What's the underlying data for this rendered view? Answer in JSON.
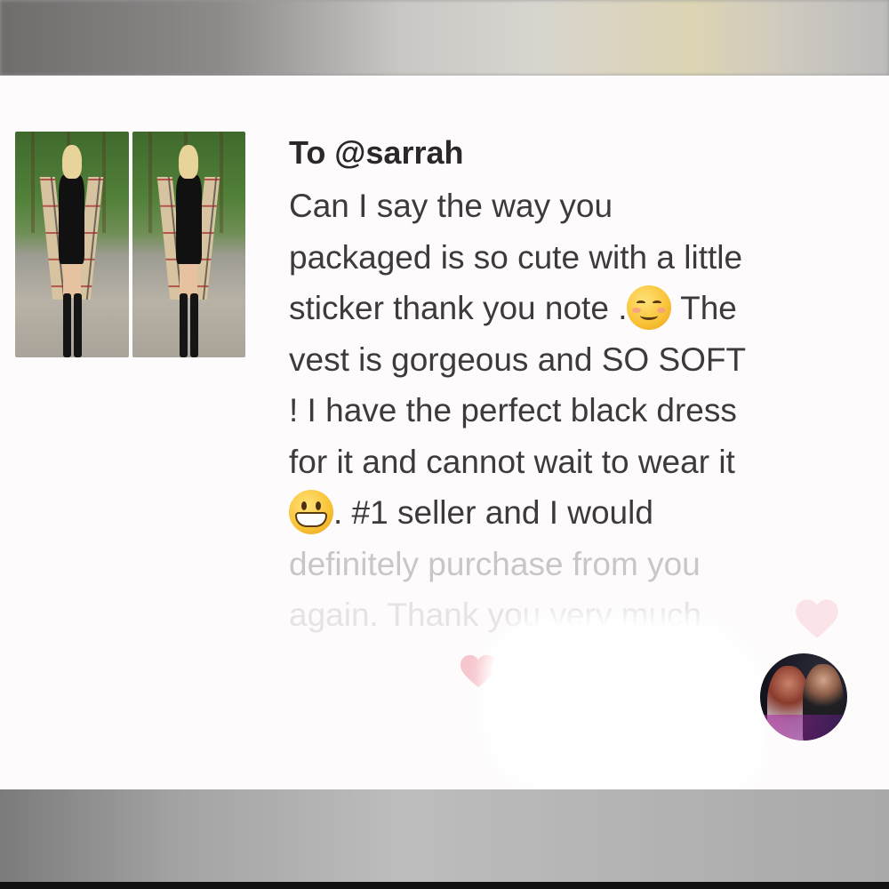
{
  "comment": {
    "recipient": "To @sarrah",
    "lines": [
      "Can I say the way you",
      "packaged is so cute with a little",
      "sticker thank you note .",
      "The",
      "vest is gorgeous and SO SOFT",
      "! I have the perfect black dress",
      "for it and cannot wait to wear it",
      ". #1 seller and I would",
      "definitely purchase from you",
      "again. Thank you very much"
    ]
  },
  "icons": {
    "smile": "smiling-face-emoji",
    "grin": "grinning-face-emoji",
    "heart": "heart-icon"
  },
  "colors": {
    "card_bg": "#fdfbfc",
    "text": "#3d3a3b",
    "heart": "#f6c6cd"
  }
}
